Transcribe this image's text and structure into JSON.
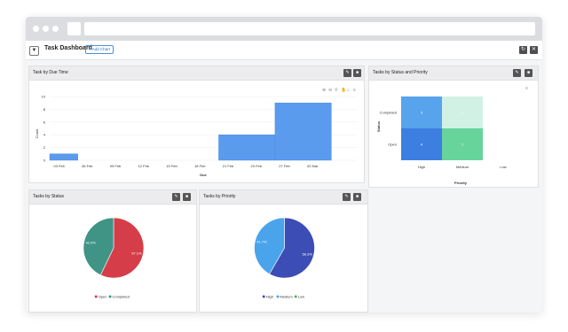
{
  "dashboard": {
    "title": "Task Dashboard",
    "add_chart_label": "+ Add Chart",
    "filter_icon": "funnel-icon",
    "header_icons": [
      "refresh-icon",
      "close-icon"
    ]
  },
  "panels": {
    "due": {
      "title": "Task by Due Time"
    },
    "heat": {
      "title": "Tasks by Status and Priority"
    },
    "status": {
      "title": "Tasks by Status"
    },
    "priority": {
      "title": "Tasks by Priority"
    }
  },
  "chart_data": [
    {
      "type": "bar",
      "title": "",
      "xlabel": "Due",
      "ylabel": "Count",
      "categories": [
        "03 Feb",
        "06 Feb",
        "09 Feb",
        "12 Feb",
        "15 Feb",
        "18 Feb",
        "21 Feb",
        "24 Feb",
        "27 Feb",
        "02 Mar"
      ],
      "bins": [
        {
          "from": "02 Feb",
          "to": "05 Feb",
          "value": 1
        },
        {
          "from": "05 Feb",
          "to": "08 Feb",
          "value": 0
        },
        {
          "from": "08 Feb",
          "to": "11 Feb",
          "value": 0
        },
        {
          "from": "11 Feb",
          "to": "14 Feb",
          "value": 0
        },
        {
          "from": "14 Feb",
          "to": "17 Feb",
          "value": 0
        },
        {
          "from": "17 Feb",
          "to": "20 Feb",
          "value": 0
        },
        {
          "from": "20 Feb",
          "to": "26 Feb",
          "value": 4
        },
        {
          "from": "26 Feb",
          "to": "04 Mar",
          "value": 9
        }
      ],
      "yticks": [
        0,
        2,
        4,
        6,
        8,
        10
      ],
      "ylim": [
        0,
        10
      ],
      "color": "#5b9bee"
    },
    {
      "type": "heatmap",
      "xlabel": "Priority",
      "ylabel": "Status",
      "x": [
        "High",
        "Medium",
        "Low"
      ],
      "y": [
        "Completed",
        "Open"
      ],
      "values": [
        [
          3,
          1,
          0
        ],
        [
          4,
          1,
          0
        ]
      ],
      "cell_labels": [
        [
          "3",
          "1",
          ""
        ],
        [
          "4",
          "1",
          ""
        ]
      ],
      "colors": [
        [
          "#57a3ec",
          "#d1f1e4",
          "#ffffff"
        ],
        [
          "#3d7fe0",
          "#66d49b",
          "#ffffff"
        ]
      ]
    },
    {
      "type": "pie",
      "series": [
        {
          "name": "Open",
          "value": 57.1,
          "label": "57.1%",
          "color": "#d53d48"
        },
        {
          "name": "Completed",
          "value": 42.9,
          "label": "42.9%",
          "color": "#3f9486"
        }
      ],
      "legend": "bottom"
    },
    {
      "type": "pie",
      "series": [
        {
          "name": "High",
          "value": 58.3,
          "label": "58.3%",
          "color": "#3c4db5"
        },
        {
          "name": "Medium",
          "value": 41.7,
          "label": "41.7%",
          "color": "#4aa4ec"
        },
        {
          "name": "Low",
          "value": 0,
          "label": "",
          "color": "#4caf50"
        }
      ],
      "legend": "bottom"
    }
  ]
}
